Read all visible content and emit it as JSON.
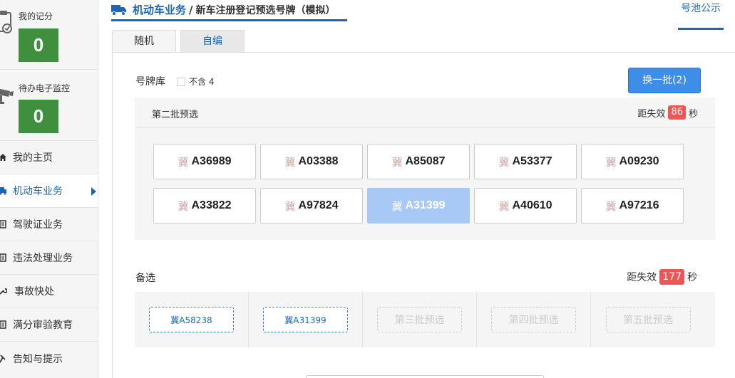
{
  "sidebar": {
    "score": {
      "label": "我的记分",
      "value": "0"
    },
    "monitor": {
      "label": "待办电子监控",
      "value": "0"
    },
    "items": [
      {
        "label": "我的主页"
      },
      {
        "label": "机动车业务"
      },
      {
        "label": "驾驶证业务"
      },
      {
        "label": "违法处理业务"
      },
      {
        "label": "事故快处"
      },
      {
        "label": "满分审验教育"
      },
      {
        "label": "告知与提示"
      }
    ]
  },
  "header": {
    "breadcrumb_main": "机动车业务",
    "breadcrumb_sep": "/",
    "breadcrumb_sub": "新车注册登记预选号牌（模拟）",
    "pool_link": "号池公示"
  },
  "tabs": [
    {
      "label": "随机"
    },
    {
      "label": "自编"
    }
  ],
  "library": {
    "label": "号牌库",
    "exclude_four": "不含 4",
    "refresh_button": "换一批(2)"
  },
  "batch": {
    "title": "第二批预选",
    "expire_prefix": "距失效",
    "expire_count": "86",
    "expire_suffix": "秒",
    "plates": [
      {
        "prov": "冀",
        "num": "A36989"
      },
      {
        "prov": "冀",
        "num": "A03388"
      },
      {
        "prov": "冀",
        "num": "A85087"
      },
      {
        "prov": "冀",
        "num": "A53377"
      },
      {
        "prov": "冀",
        "num": "A09230"
      },
      {
        "prov": "冀",
        "num": "A33822"
      },
      {
        "prov": "冀",
        "num": "A97824"
      },
      {
        "prov": "冀",
        "num": "A31399"
      },
      {
        "prov": "冀",
        "num": "A40610"
      },
      {
        "prov": "冀",
        "num": "A97216"
      }
    ]
  },
  "alternates": {
    "label": "备选",
    "expire_prefix": "距失效",
    "expire_count": "177",
    "expire_suffix": "秒",
    "slots": [
      {
        "text": "冀A58238"
      },
      {
        "text": "冀A31399"
      },
      {
        "text": "第三批预选"
      },
      {
        "text": "第四批预选"
      },
      {
        "text": "第五批预选"
      }
    ]
  },
  "colors": {
    "accent": "#1f64b5",
    "score_green": "#3f8f3f",
    "button_blue": "#3d8ee8",
    "selected_plate": "#a8c9f5",
    "countdown_red": "#e55555"
  }
}
